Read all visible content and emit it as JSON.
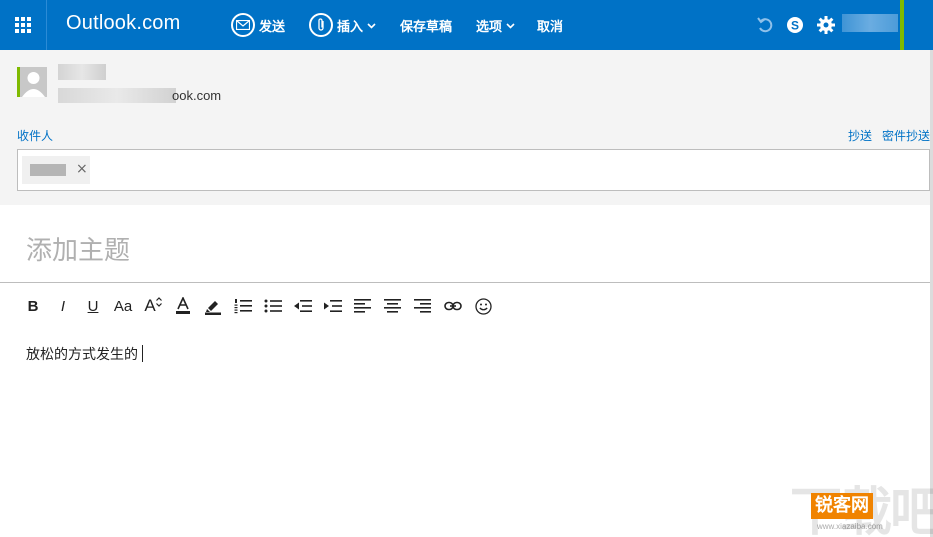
{
  "app": {
    "brand": "Outlook.com"
  },
  "commands": {
    "send": "发送",
    "insert": "插入",
    "save_draft": "保存草稿",
    "options": "选项",
    "cancel": "取消"
  },
  "icons": {
    "waffle": "app-launcher-icon",
    "send": "envelope-icon",
    "insert": "paperclip-icon",
    "undo": "undo-icon",
    "skype": "skype-icon",
    "settings": "gear-icon"
  },
  "header": {
    "sender_email_suffix": "ook.com",
    "to_label": "收件人",
    "cc_label": "抄送",
    "bcc_label": "密件抄送",
    "chip_remove": "×"
  },
  "subject": {
    "placeholder": "添加主题",
    "value": ""
  },
  "toolbar": {
    "bold": "B",
    "italic": "I",
    "underline": "U",
    "font_size": "Aa",
    "grow_font": "A"
  },
  "body": {
    "text": "放松的方式发生的"
  },
  "watermark": {
    "big": "下载吧",
    "logo": "锐客网",
    "url": "www.xiazaiba.com"
  },
  "colors": {
    "accent": "#0072c6",
    "accent_green": "#7fba00",
    "header_bg": "#f4f4f4"
  }
}
